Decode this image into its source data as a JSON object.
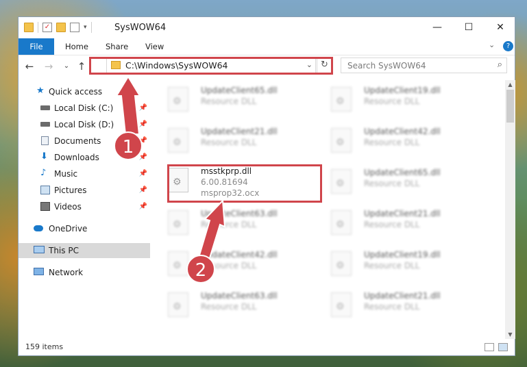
{
  "window": {
    "title": "SysWOW64",
    "controls": {
      "minimize": "—",
      "maximize": "☐",
      "close": "✕"
    }
  },
  "ribbon": {
    "tabs": [
      "File",
      "Home",
      "Share",
      "View"
    ],
    "help": "?",
    "collapse": "⌄"
  },
  "navbar": {
    "back": "←",
    "forward": "→",
    "recent": "⌄",
    "up": "↑",
    "address": "C:\\Windows\\SysWOW64",
    "search_placeholder": "Search SysWOW64"
  },
  "sidebar": {
    "items": [
      {
        "label": "Quick access",
        "icon": "star-icon",
        "pinned": false
      },
      {
        "label": "Local Disk (C:)",
        "icon": "drive-icon",
        "pinned": true
      },
      {
        "label": "Local Disk (D:)",
        "icon": "drive-icon",
        "pinned": true
      },
      {
        "label": "Documents",
        "icon": "documents-icon",
        "pinned": true
      },
      {
        "label": "Downloads",
        "icon": "download-icon",
        "pinned": true
      },
      {
        "label": "Music",
        "icon": "music-icon",
        "pinned": true
      },
      {
        "label": "Pictures",
        "icon": "pictures-icon",
        "pinned": true
      },
      {
        "label": "Videos",
        "icon": "videos-icon",
        "pinned": true
      },
      {
        "label": "OneDrive",
        "icon": "cloud-icon",
        "pinned": false
      },
      {
        "label": "This PC",
        "icon": "computer-icon",
        "pinned": false,
        "selected": true
      },
      {
        "label": "Network",
        "icon": "network-icon",
        "pinned": false
      }
    ]
  },
  "files": {
    "highlighted": {
      "name": "msstkprp.dll",
      "version": "6.00.81694",
      "description": "msprop32.ocx"
    },
    "left_column": [
      {
        "name": "UpdateClient65.dll",
        "type": "Resource DLL"
      },
      {
        "name": "UpdateClient21.dll",
        "type": "Resource DLL"
      },
      {
        "name": "UpdateClient63.dll",
        "type": "Resource DLL"
      },
      {
        "name": "UpdateClient42.dll",
        "type": "Resource DLL"
      },
      {
        "name": "UpdateClient63.dll",
        "type": "Resource DLL"
      }
    ],
    "right_column": [
      {
        "name": "UpdateClient19.dll",
        "type": "Resource DLL"
      },
      {
        "name": "UpdateClient42.dll",
        "type": "Resource DLL"
      },
      {
        "name": "UpdateClient65.dll",
        "type": "Resource DLL"
      },
      {
        "name": "UpdateClient21.dll",
        "type": "Resource DLL"
      },
      {
        "name": "UpdateClient19.dll",
        "type": "Resource DLL"
      },
      {
        "name": "UpdateClient21.dll",
        "type": "Resource DLL"
      }
    ]
  },
  "status": {
    "item_count": "159 items"
  },
  "callouts": {
    "step1": "1",
    "step2": "2"
  },
  "colors": {
    "accent": "#1979ca",
    "highlight": "#d0454b",
    "selected": "#d9d9d9"
  }
}
